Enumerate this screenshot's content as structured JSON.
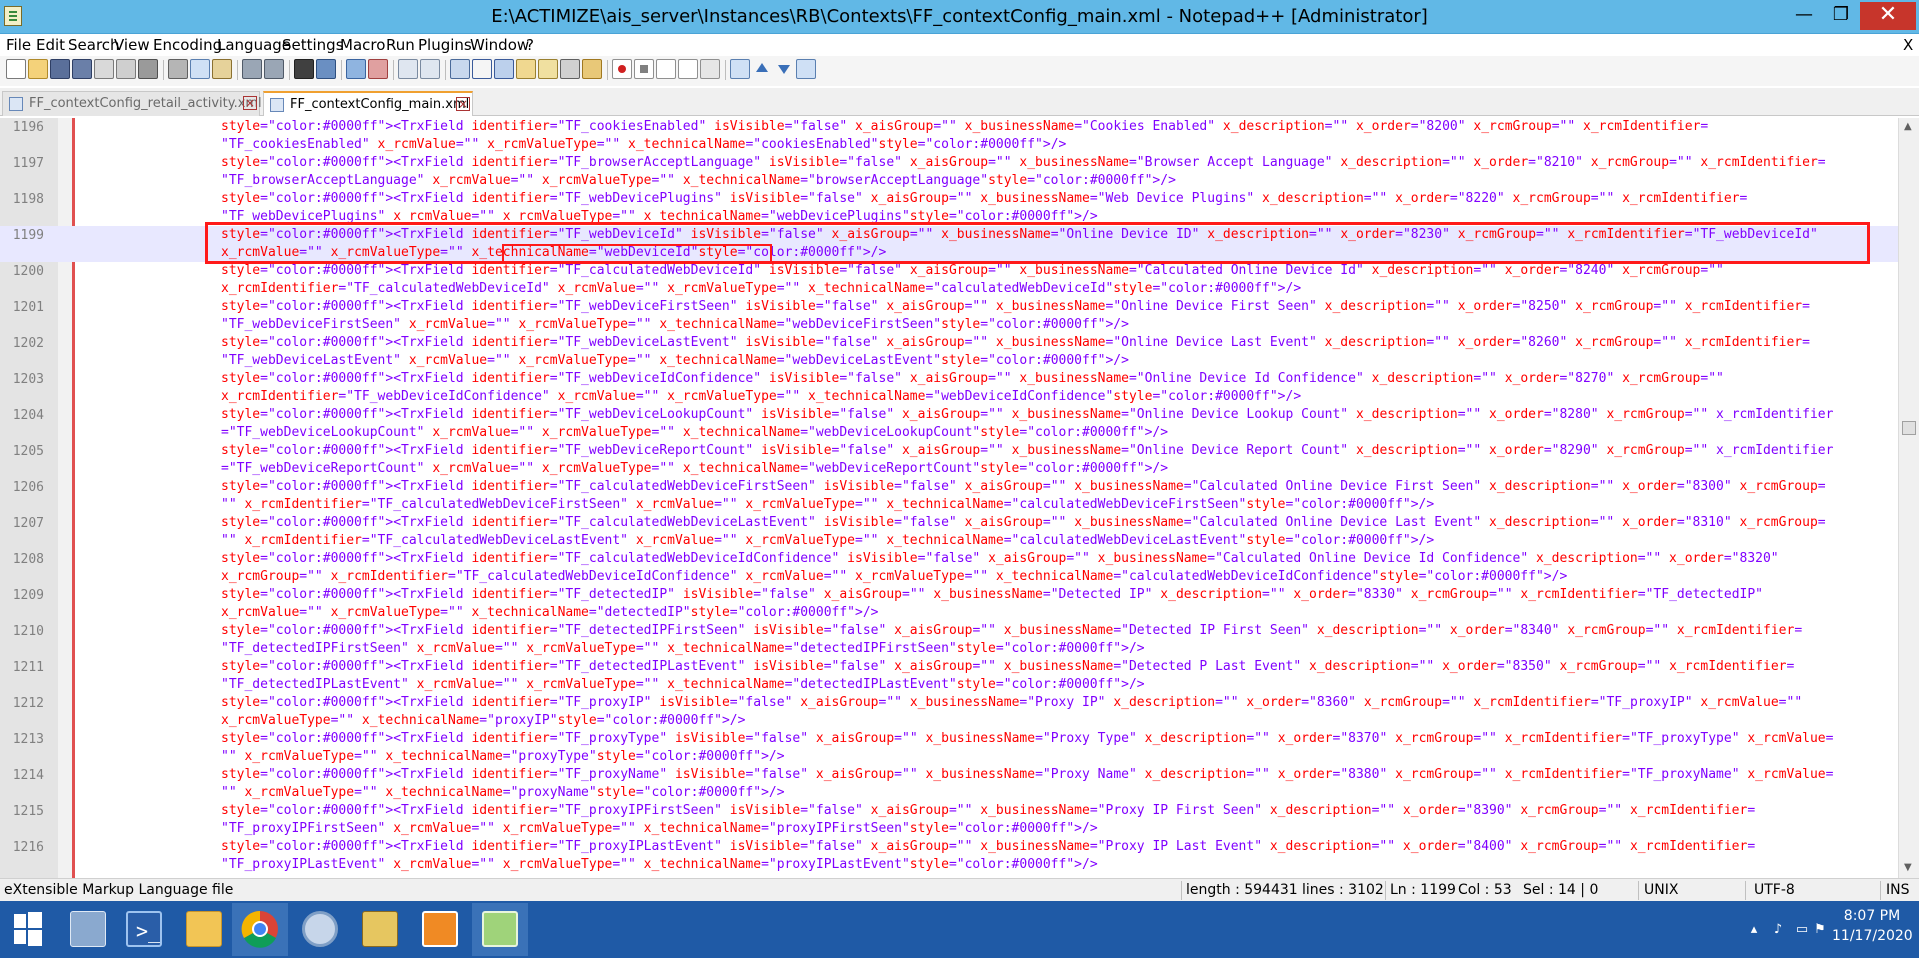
{
  "window": {
    "title": "E:\\ACTIMIZE\\ais_server\\Instances\\RB\\Contexts\\FF_contextConfig_main.xml - Notepad++ [Administrator]",
    "minimize_glyph": "—",
    "maximize_glyph": "❐",
    "close_glyph": "✕"
  },
  "menu": {
    "items": [
      "File",
      "Edit",
      "Search",
      "View",
      "Encoding",
      "Language",
      "Settings",
      "Macro",
      "Run",
      "Plugins",
      "Window",
      "?"
    ],
    "close_glyph": "X"
  },
  "toolbar": {
    "icons": [
      "new-file-icon",
      "open-file-icon",
      "save-icon",
      "save-all-icon",
      "close-icon",
      "close-all-icon",
      "print-icon",
      "cut-icon",
      "copy-icon",
      "paste-icon",
      "undo-icon",
      "redo-icon",
      "find-icon",
      "replace-icon",
      "zoom-in-icon",
      "zoom-out-icon",
      "sync-vertical-icon",
      "sync-horizontal-icon",
      "word-wrap-icon",
      "show-all-chars-icon",
      "indent-guide-icon",
      "user-language-icon",
      "doc-map-icon",
      "function-list-icon",
      "folder-workspace-icon",
      "record-macro-icon",
      "stop-record-icon",
      "playback-icon",
      "run-macro-multiple-icon",
      "save-macro-icon",
      "collapse-all-icon",
      "up-arrow-icon",
      "down-arrow-icon",
      "expand-all-icon"
    ]
  },
  "tabs": [
    {
      "label": "FF_contextConfig_retail_activity.xml",
      "active": false
    },
    {
      "label": "FF_contextConfig_main.xml",
      "active": true
    }
  ],
  "editor": {
    "current_line": 1199,
    "lines": [
      {
        "num": "1196",
        "text": "<TrxField identifier=\"TF_cookiesEnabled\" isVisible=\"false\" x_aisGroup=\"\" x_businessName=\"Cookies Enabled\" x_description=\"\" x_order=\"8200\" x_rcmGroup=\"\" x_rcmIdentifier=\n\"TF_cookiesEnabled\" x_rcmValue=\"\" x_rcmValueType=\"\" x_technicalName=\"cookiesEnabled\"/>"
      },
      {
        "num": "1197",
        "text": "<TrxField identifier=\"TF_browserAcceptLanguage\" isVisible=\"false\" x_aisGroup=\"\" x_businessName=\"Browser Accept Language\" x_description=\"\" x_order=\"8210\" x_rcmGroup=\"\" x_rcmIdentifier=\n\"TF_browserAcceptLanguage\" x_rcmValue=\"\" x_rcmValueType=\"\" x_technicalName=\"browserAcceptLanguage\"/>"
      },
      {
        "num": "1198",
        "text": "<TrxField identifier=\"TF_webDevicePlugins\" isVisible=\"false\" x_aisGroup=\"\" x_businessName=\"Web Device Plugins\" x_description=\"\" x_order=\"8220\" x_rcmGroup=\"\" x_rcmIdentifier=\n\"TF_webDevicePlugins\" x_rcmValue=\"\" x_rcmValueType=\"\" x_technicalName=\"webDevicePlugins\"/>"
      },
      {
        "num": "1199",
        "text": "<TrxField identifier=\"TF_webDeviceId\" isVisible=\"false\" x_aisGroup=\"\" x_businessName=\"Online Device ID\" x_description=\"\" x_order=\"8230\" x_rcmGroup=\"\" x_rcmIdentifier=\"TF_webDeviceId\"\nx_rcmValue=\"\" x_rcmValueType=\"\" x_technicalName=\"webDeviceId\"/>"
      },
      {
        "num": "1200",
        "text": "<TrxField identifier=\"TF_calculatedWebDeviceId\" isVisible=\"false\" x_aisGroup=\"\" x_businessName=\"Calculated Online Device Id\" x_description=\"\" x_order=\"8240\" x_rcmGroup=\"\"\nx_rcmIdentifier=\"TF_calculatedWebDeviceId\" x_rcmValue=\"\" x_rcmValueType=\"\" x_technicalName=\"calculatedWebDeviceId\"/>"
      },
      {
        "num": "1201",
        "text": "<TrxField identifier=\"TF_webDeviceFirstSeen\" isVisible=\"false\" x_aisGroup=\"\" x_businessName=\"Online Device First Seen\" x_description=\"\" x_order=\"8250\" x_rcmGroup=\"\" x_rcmIdentifier=\n\"TF_webDeviceFirstSeen\" x_rcmValue=\"\" x_rcmValueType=\"\" x_technicalName=\"webDeviceFirstSeen\"/>"
      },
      {
        "num": "1202",
        "text": "<TrxField identifier=\"TF_webDeviceLastEvent\" isVisible=\"false\" x_aisGroup=\"\" x_businessName=\"Online Device Last Event\" x_description=\"\" x_order=\"8260\" x_rcmGroup=\"\" x_rcmIdentifier=\n\"TF_webDeviceLastEvent\" x_rcmValue=\"\" x_rcmValueType=\"\" x_technicalName=\"webDeviceLastEvent\"/>"
      },
      {
        "num": "1203",
        "text": "<TrxField identifier=\"TF_webDeviceIdConfidence\" isVisible=\"false\" x_aisGroup=\"\" x_businessName=\"Online Device Id Confidence\" x_description=\"\" x_order=\"8270\" x_rcmGroup=\"\"\nx_rcmIdentifier=\"TF_webDeviceIdConfidence\" x_rcmValue=\"\" x_rcmValueType=\"\" x_technicalName=\"webDeviceIdConfidence\"/>"
      },
      {
        "num": "1204",
        "text": "<TrxField identifier=\"TF_webDeviceLookupCount\" isVisible=\"false\" x_aisGroup=\"\" x_businessName=\"Online Device Lookup Count\" x_description=\"\" x_order=\"8280\" x_rcmGroup=\"\" x_rcmIdentifier\n=\"TF_webDeviceLookupCount\" x_rcmValue=\"\" x_rcmValueType=\"\" x_technicalName=\"webDeviceLookupCount\"/>"
      },
      {
        "num": "1205",
        "text": "<TrxField identifier=\"TF_webDeviceReportCount\" isVisible=\"false\" x_aisGroup=\"\" x_businessName=\"Online Device Report Count\" x_description=\"\" x_order=\"8290\" x_rcmGroup=\"\" x_rcmIdentifier\n=\"TF_webDeviceReportCount\" x_rcmValue=\"\" x_rcmValueType=\"\" x_technicalName=\"webDeviceReportCount\"/>"
      },
      {
        "num": "1206",
        "text": "<TrxField identifier=\"TF_calculatedWebDeviceFirstSeen\" isVisible=\"false\" x_aisGroup=\"\" x_businessName=\"Calculated Online Device First Seen\" x_description=\"\" x_order=\"8300\" x_rcmGroup=\n\"\" x_rcmIdentifier=\"TF_calculatedWebDeviceFirstSeen\" x_rcmValue=\"\" x_rcmValueType=\"\" x_technicalName=\"calculatedWebDeviceFirstSeen\"/>"
      },
      {
        "num": "1207",
        "text": "<TrxField identifier=\"TF_calculatedWebDeviceLastEvent\" isVisible=\"false\" x_aisGroup=\"\" x_businessName=\"Calculated Online Device Last Event\" x_description=\"\" x_order=\"8310\" x_rcmGroup=\n\"\" x_rcmIdentifier=\"TF_calculatedWebDeviceLastEvent\" x_rcmValue=\"\" x_rcmValueType=\"\" x_technicalName=\"calculatedWebDeviceLastEvent\"/>"
      },
      {
        "num": "1208",
        "text": "<TrxField identifier=\"TF_calculatedWebDeviceIdConfidence\" isVisible=\"false\" x_aisGroup=\"\" x_businessName=\"Calculated Online Device Id Confidence\" x_description=\"\" x_order=\"8320\"\nx_rcmGroup=\"\" x_rcmIdentifier=\"TF_calculatedWebDeviceIdConfidence\" x_rcmValue=\"\" x_rcmValueType=\"\" x_technicalName=\"calculatedWebDeviceIdConfidence\"/>"
      },
      {
        "num": "1209",
        "text": "<TrxField identifier=\"TF_detectedIP\" isVisible=\"false\" x_aisGroup=\"\" x_businessName=\"Detected IP\" x_description=\"\" x_order=\"8330\" x_rcmGroup=\"\" x_rcmIdentifier=\"TF_detectedIP\"\nx_rcmValue=\"\" x_rcmValueType=\"\" x_technicalName=\"detectedIP\"/>"
      },
      {
        "num": "1210",
        "text": "<TrxField identifier=\"TF_detectedIPFirstSeen\" isVisible=\"false\" x_aisGroup=\"\" x_businessName=\"Detected IP First Seen\" x_description=\"\" x_order=\"8340\" x_rcmGroup=\"\" x_rcmIdentifier=\n\"TF_detectedIPFirstSeen\" x_rcmValue=\"\" x_rcmValueType=\"\" x_technicalName=\"detectedIPFirstSeen\"/>"
      },
      {
        "num": "1211",
        "text": "<TrxField identifier=\"TF_detectedIPLastEvent\" isVisible=\"false\" x_aisGroup=\"\" x_businessName=\"Detected P Last Event\" x_description=\"\" x_order=\"8350\" x_rcmGroup=\"\" x_rcmIdentifier=\n\"TF_detectedIPLastEvent\" x_rcmValue=\"\" x_rcmValueType=\"\" x_technicalName=\"detectedIPLastEvent\"/>"
      },
      {
        "num": "1212",
        "text": "<TrxField identifier=\"TF_proxyIP\" isVisible=\"false\" x_aisGroup=\"\" x_businessName=\"Proxy IP\" x_description=\"\" x_order=\"8360\" x_rcmGroup=\"\" x_rcmIdentifier=\"TF_proxyIP\" x_rcmValue=\"\"\nx_rcmValueType=\"\" x_technicalName=\"proxyIP\"/>"
      },
      {
        "num": "1213",
        "text": "<TrxField identifier=\"TF_proxyType\" isVisible=\"false\" x_aisGroup=\"\" x_businessName=\"Proxy Type\" x_description=\"\" x_order=\"8370\" x_rcmGroup=\"\" x_rcmIdentifier=\"TF_proxyType\" x_rcmValue=\n\"\" x_rcmValueType=\"\" x_technicalName=\"proxyType\"/>"
      },
      {
        "num": "1214",
        "text": "<TrxField identifier=\"TF_proxyName\" isVisible=\"false\" x_aisGroup=\"\" x_businessName=\"Proxy Name\" x_description=\"\" x_order=\"8380\" x_rcmGroup=\"\" x_rcmIdentifier=\"TF_proxyName\" x_rcmValue=\n\"\" x_rcmValueType=\"\" x_technicalName=\"proxyName\"/>"
      },
      {
        "num": "1215",
        "text": "<TrxField identifier=\"TF_proxyIPFirstSeen\" isVisible=\"false\" x_aisGroup=\"\" x_businessName=\"Proxy IP First Seen\" x_description=\"\" x_order=\"8390\" x_rcmGroup=\"\" x_rcmIdentifier=\n\"TF_proxyIPFirstSeen\" x_rcmValue=\"\" x_rcmValueType=\"\" x_technicalName=\"proxyIPFirstSeen\"/>"
      },
      {
        "num": "1216",
        "text": "<TrxField identifier=\"TF_proxyIPLastEvent\" isVisible=\"false\" x_aisGroup=\"\" x_businessName=\"Proxy IP Last Event\" x_description=\"\" x_order=\"8400\" x_rcmGroup=\"\" x_rcmIdentifier=\n\"TF_proxyIPLastEvent\" x_rcmValue=\"\" x_rcmValueType=\"\" x_technicalName=\"proxyIPLastEvent\"/>"
      }
    ]
  },
  "statusbar": {
    "file_type": "eXtensible Markup Language file",
    "length": "length : 594431",
    "lines": "lines : 3102",
    "ln": "Ln : 1199",
    "col": "Col : 53",
    "sel": "Sel : 14 | 0",
    "eol": "UNIX",
    "encoding": "UTF-8",
    "mode": "INS"
  },
  "taskbar": {
    "apps": [
      "start-button",
      "server-manager-icon",
      "powershell-icon",
      "file-explorer-icon",
      "chrome-icon",
      "control-panel-icon",
      "tools-icon",
      "actimize-icon",
      "notepadpp-icon"
    ],
    "time": "8:07 PM",
    "date": "11/17/2020"
  },
  "colors": {
    "titlebar": "#61b8e6",
    "tag": "#0000ff",
    "attr": "#ff0000",
    "value": "#8000ff",
    "highlight": "#ff1a1a",
    "taskbar": "#1f5aa6"
  }
}
